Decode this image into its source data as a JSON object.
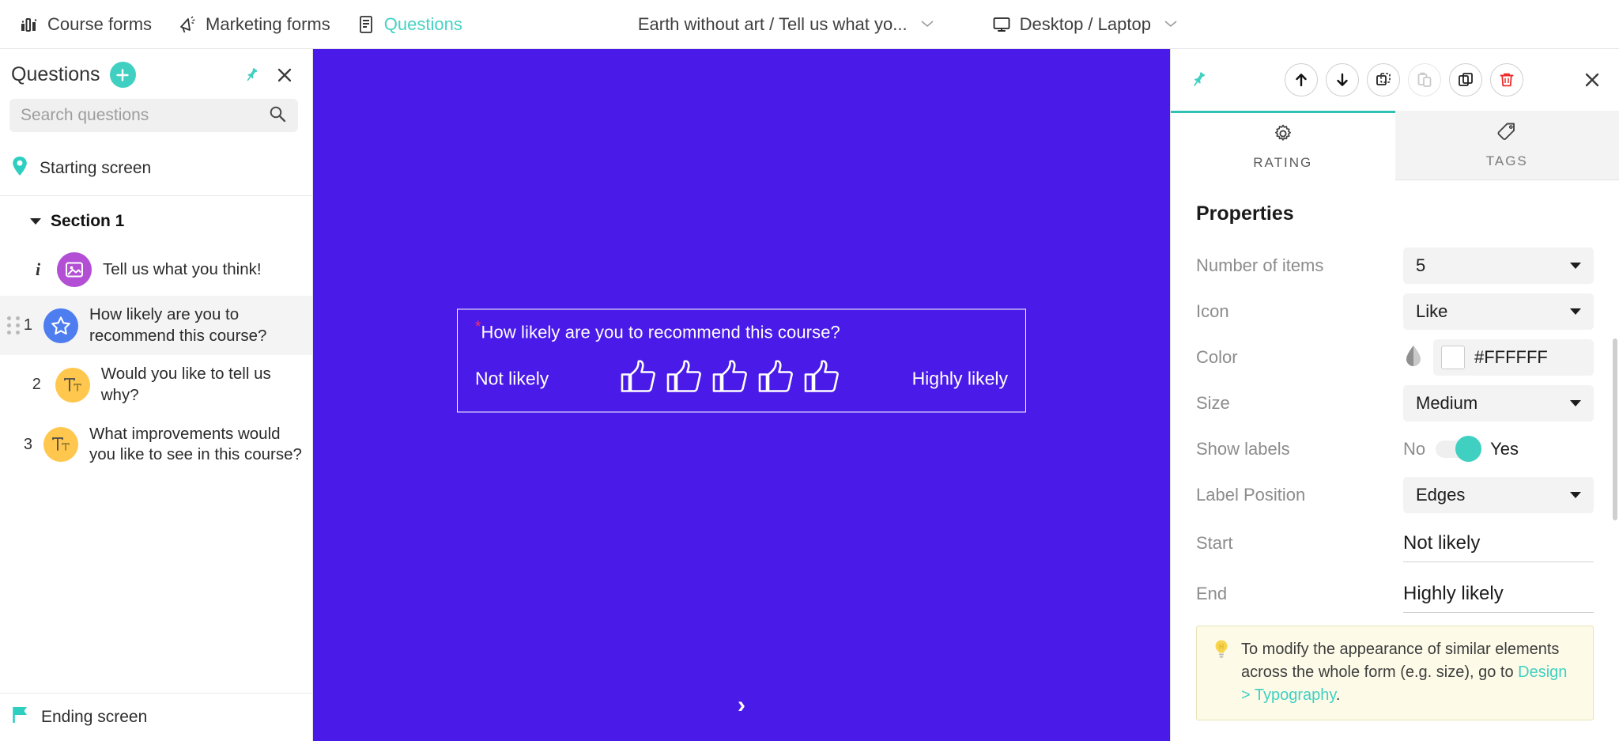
{
  "topbar": {
    "items": [
      {
        "label": "Course forms",
        "icon": "bar-chart-icon",
        "active": false
      },
      {
        "label": "Marketing forms",
        "icon": "megaphone-icon",
        "active": false
      },
      {
        "label": "Questions",
        "icon": "document-list-icon",
        "active": true
      }
    ],
    "form_selector": {
      "label": "Earth without art / Tell us what yo...",
      "chevron": "⌄"
    },
    "device_selector": {
      "label": "Desktop / Laptop",
      "icon": "monitor-icon",
      "chevron": "⌄"
    }
  },
  "sidebar": {
    "title": "Questions",
    "add_button_label": "+",
    "pin_icon": "pin-icon",
    "close_icon": "close-icon",
    "search": {
      "placeholder": "Search questions",
      "value": "",
      "icon": "search-icon"
    },
    "starting_screen": {
      "label": "Starting screen",
      "icon": "location-pin-icon",
      "color": "#2ecfc0"
    },
    "section": {
      "label": "Section 1",
      "expanded": true
    },
    "questions": [
      {
        "num": "i",
        "is_info": true,
        "text": "Tell us what you think!",
        "icon": "image-icon",
        "color": "#b24fd4",
        "selected": false,
        "draggable": false
      },
      {
        "num": "1",
        "is_info": false,
        "text": "How likely are you to recommend this course?",
        "icon": "star-icon",
        "color": "#4e7df0",
        "selected": true,
        "draggable": true
      },
      {
        "num": "2",
        "is_info": false,
        "text": "Would you like to tell us why?",
        "icon": "text-icon",
        "color": "#ffc74d",
        "selected": false,
        "draggable": false
      },
      {
        "num": "3",
        "is_info": false,
        "text": "What  improvements would you like to see in this course?",
        "icon": "text-icon",
        "color": "#ffc74d",
        "selected": false,
        "draggable": false
      }
    ],
    "ending_screen": {
      "label": "Ending screen",
      "icon": "flag-icon",
      "color": "#2ecfc0"
    }
  },
  "canvas": {
    "background_color": "#4A1AE8",
    "question": {
      "required_marker": "*",
      "title": "How likely are you to recommend this course?",
      "start_label": "Not likely",
      "end_label": "Highly likely",
      "items_count": 5,
      "item_icon": "thumbs-up-icon",
      "item_color": "#FFFFFF"
    },
    "next_arrow": "›"
  },
  "right_panel": {
    "toolbar": {
      "pin_icon": "pin-icon",
      "buttons": [
        {
          "name": "move-up-button",
          "icon": "arrow-up-icon",
          "disabled": false
        },
        {
          "name": "move-down-button",
          "icon": "arrow-down-icon",
          "disabled": false
        },
        {
          "name": "cut-button",
          "icon": "cut-icon",
          "disabled": false
        },
        {
          "name": "paste-button",
          "icon": "paste-icon",
          "disabled": true
        },
        {
          "name": "copy-button",
          "icon": "copy-icon",
          "disabled": false
        },
        {
          "name": "delete-button",
          "icon": "trash-icon",
          "disabled": false,
          "color": "#ed2b2b"
        }
      ],
      "close_icon": "close-icon"
    },
    "tabs": [
      {
        "label": "RATING",
        "icon": "gear-icon",
        "active": true
      },
      {
        "label": "TAGS",
        "icon": "tag-icon",
        "active": false
      }
    ],
    "properties_title": "Properties",
    "properties": {
      "number_of_items": {
        "label": "Number of items",
        "value": "5"
      },
      "icon": {
        "label": "Icon",
        "value": "Like"
      },
      "color": {
        "label": "Color",
        "value": "#FFFFFF",
        "swatch": "#FFFFFF",
        "dropper_icon": "droplet-icon"
      },
      "size": {
        "label": "Size",
        "value": "Medium"
      },
      "show_labels": {
        "label": "Show labels",
        "off_text": "No",
        "on_text": "Yes",
        "value": "Yes"
      },
      "label_position": {
        "label": "Label Position",
        "value": "Edges"
      },
      "start": {
        "label": "Start",
        "value": "Not likely"
      },
      "end": {
        "label": "End",
        "value": "Highly likely"
      }
    },
    "tip": {
      "icon": "lightbulb-icon",
      "text_before": "To modify the appearance of similar elements across the whole form (e.g. size), go to ",
      "link": "Design > Typography",
      "text_after": "."
    }
  }
}
